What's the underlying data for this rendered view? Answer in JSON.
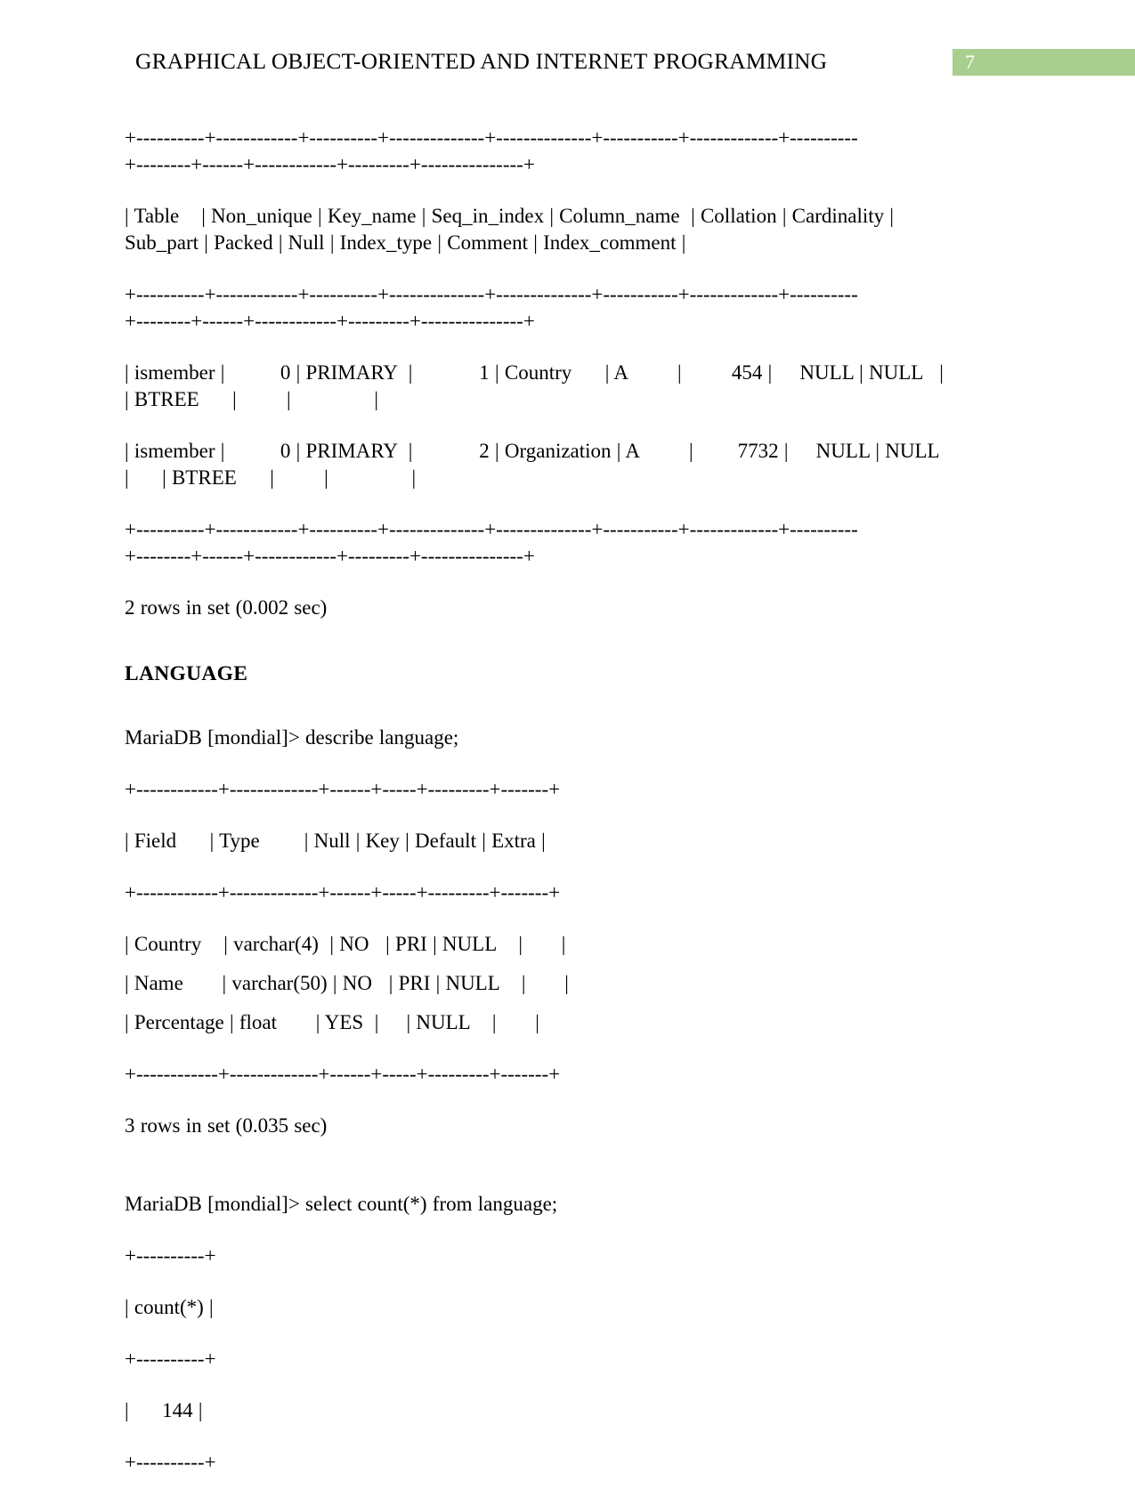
{
  "header": {
    "title": "GRAPHICAL OBJECT-ORIENTED AND INTERNET PROGRAMMING",
    "page_number": "7",
    "accent_color": "#a8cf8f"
  },
  "document": {
    "show_index_output": {
      "separator_top_line1": "+----------+------------+----------+--------------+--------------+-----------+-------------+----------",
      "separator_top_line2": "+--------+------+------------+---------+---------------+",
      "column_header_line1": "| Table    | Non_unique | Key_name | Seq_in_index | Column_name  | Collation | Cardinality |",
      "column_header_line2": "Sub_part | Packed | Null | Index_type | Comment | Index_comment |",
      "separator_mid_line1": "+----------+------------+----------+--------------+--------------+-----------+-------------+----------",
      "separator_mid_line2": "+--------+------+------------+---------+---------------+",
      "row1_line1": "| ismember |          0 | PRIMARY  |            1 | Country      | A         |         454 |     NULL | NULL   |",
      "row1_line2": "| BTREE      |         |               |",
      "row2_line1": "| ismember |          0 | PRIMARY  |            2 | Organization | A         |        7732 |     NULL | NULL",
      "row2_line2": "|      | BTREE      |         |               |",
      "separator_bottom_line1": "+----------+------------+----------+--------------+--------------+-----------+-------------+----------",
      "separator_bottom_line2": "+--------+------+------------+---------+---------------+",
      "rows_in_set": "2 rows in set (0.002 sec)"
    },
    "language_section": {
      "heading": "LANGUAGE",
      "describe_prompt": "MariaDB [mondial]> describe language;",
      "describe_separator_top": "+------------+-------------+------+-----+---------+-------+",
      "describe_header": "| Field      | Type        | Null | Key | Default | Extra |",
      "describe_separator_mid": "+------------+-------------+------+-----+---------+-------+",
      "describe_row_country": "| Country    | varchar(4)  | NO   | PRI | NULL    |       |",
      "describe_row_name": "| Name       | varchar(50) | NO   | PRI | NULL    |       |",
      "describe_row_percentage": "| Percentage | float       | YES  |     | NULL    |       |",
      "describe_separator_bottom": "+------------+-------------+------+-----+---------+-------+",
      "describe_rows_in_set": "3 rows in set (0.035 sec)",
      "count_prompt": "MariaDB [mondial]> select count(*) from language;",
      "count_separator_top": "+----------+",
      "count_header": "| count(*) |",
      "count_separator_mid": "+----------+",
      "count_value_row": "|      144 |",
      "count_separator_bottom": "+----------+"
    }
  }
}
